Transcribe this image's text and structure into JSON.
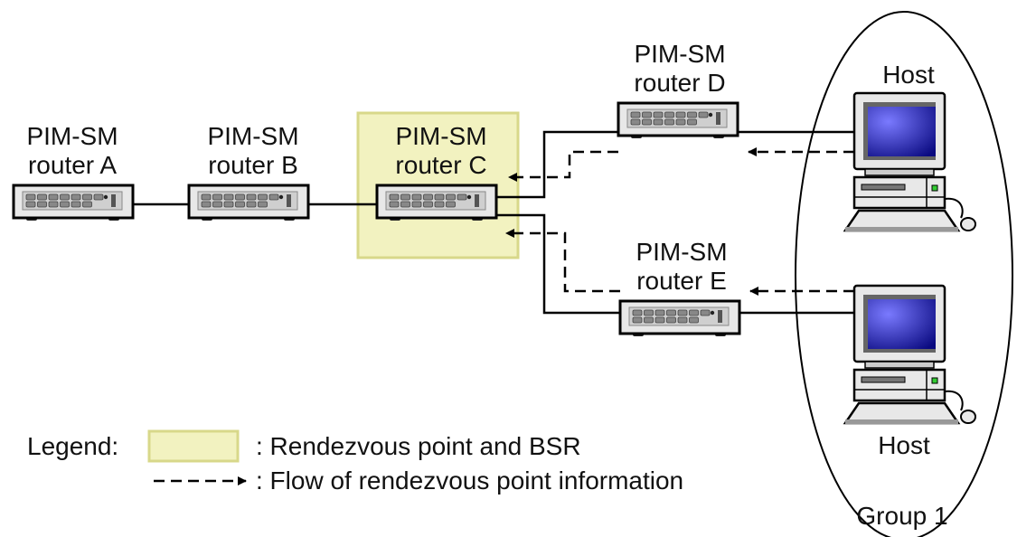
{
  "routers": [
    {
      "id": "a",
      "line1": "PIM-SM",
      "line2": "router A"
    },
    {
      "id": "b",
      "line1": "PIM-SM",
      "line2": "router B"
    },
    {
      "id": "c",
      "line1": "PIM-SM",
      "line2": "router C"
    },
    {
      "id": "d",
      "line1": "PIM-SM",
      "line2": "router D"
    },
    {
      "id": "e",
      "line1": "PIM-SM",
      "line2": "router E"
    }
  ],
  "hosts": [
    {
      "label": "Host"
    },
    {
      "label": "Host"
    }
  ],
  "group_label": "Group 1",
  "legend": {
    "title": "Legend:",
    "rp_text": ": Rendezvous point and BSR",
    "flow_text": ": Flow of rendezvous point information"
  },
  "colors": {
    "rp_fill": "#f2f2c0",
    "rp_border": "#d8d88a",
    "screen": "#2a2aa8",
    "line": "#000000"
  }
}
